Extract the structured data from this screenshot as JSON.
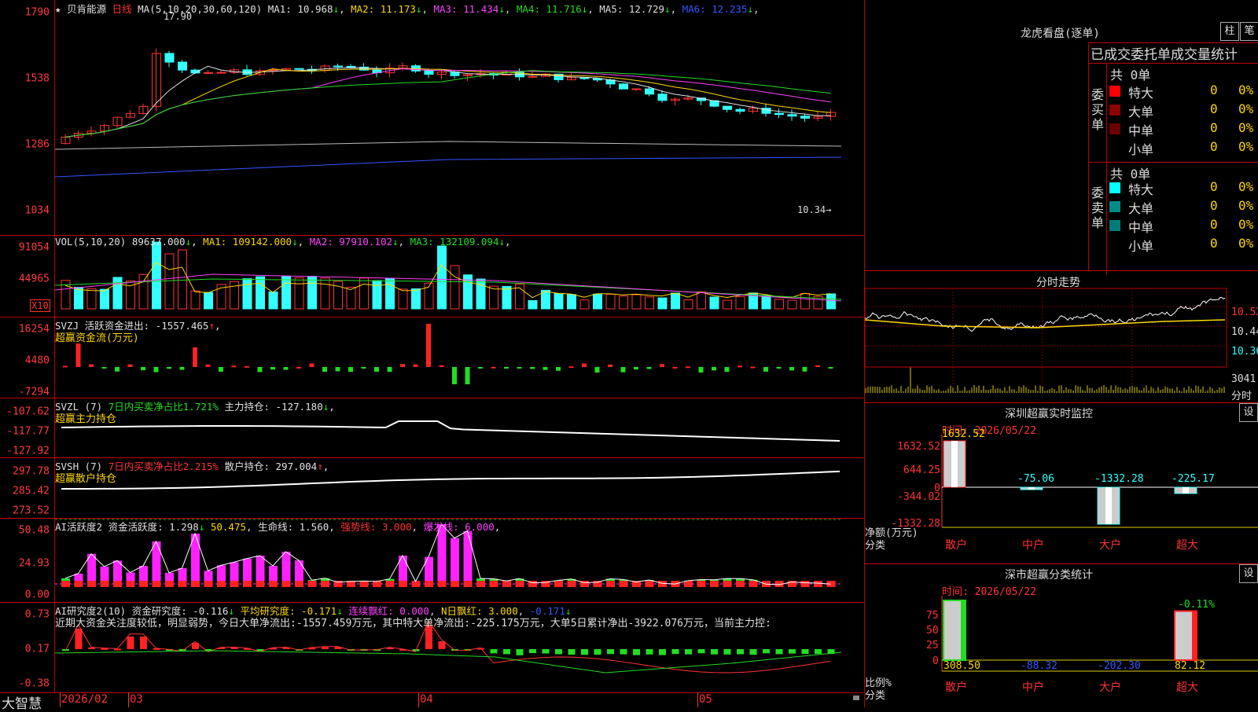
{
  "stock": {
    "name": "贝肯能源",
    "period": "日线",
    "star": "★"
  },
  "price_panel": {
    "ma_label": "MA(5,10,20,30,60,120)",
    "ma": [
      {
        "label": "MA1:",
        "value": "10.968",
        "arrow": "↓",
        "color": "#e0e0e0"
      },
      {
        "label": "MA2:",
        "value": "11.173",
        "arrow": "↓",
        "color": "#ffd700"
      },
      {
        "label": "MA3:",
        "value": "11.434",
        "arrow": "↓",
        "color": "#ff40ff"
      },
      {
        "label": "MA4:",
        "value": "11.716",
        "arrow": "↓",
        "color": "#22dd22"
      },
      {
        "label": "MA5:",
        "value": "12.729",
        "arrow": "↓",
        "color": "#dddddd"
      },
      {
        "label": "MA6:",
        "value": "12.235",
        "arrow": "↓",
        "color": "#3355ff"
      }
    ],
    "y_labels": [
      "1790",
      "1538",
      "1286",
      "1034"
    ],
    "high_label": "17.90",
    "last_label": "10.34",
    "last_arrow": "→"
  },
  "vol_panel": {
    "label": "VOL(5,10,20)",
    "value": "89637.000",
    "value_arrow": "↓",
    "ma": [
      {
        "label": "MA1:",
        "value": "109142.000",
        "arrow": "↓",
        "color": "#ffd700"
      },
      {
        "label": "MA2:",
        "value": "97910.102",
        "arrow": "↓",
        "color": "#ff40ff"
      },
      {
        "label": "MA3:",
        "value": "132109.094",
        "arrow": "↓",
        "color": "#22dd22"
      }
    ],
    "y_labels": [
      "91054",
      "44965"
    ],
    "unit_box": "X10"
  },
  "svzj_panel": {
    "label": "SVZJ",
    "metric_label": "活跃资金进出:",
    "metric_value": "-1557.465",
    "metric_arrow": "↑",
    "subtitle": "超赢资金流(万元)",
    "y_labels": [
      "16254",
      "4480",
      "-7294"
    ]
  },
  "svzl_panel": {
    "label": "SVZL (7)",
    "ratio_text": "7日内买卖净占比1.721%",
    "metric_label": "主力持仓:",
    "metric_value": "-127.180",
    "metric_arrow": "↓",
    "subtitle": "超赢主力持仓",
    "y_labels": [
      "-107.62",
      "-117.77",
      "-127.92"
    ]
  },
  "svsh_panel": {
    "label": "SVSH (7)",
    "ratio_text": "7日内买卖净占比2.215%",
    "metric_label": "散户持仓:",
    "metric_value": "297.004",
    "metric_arrow": "↑",
    "subtitle": "超赢散户持仓",
    "y_labels": [
      "297.78",
      "285.42",
      "273.52"
    ]
  },
  "ai_active_panel": {
    "label": "AI活跃度2",
    "items": [
      {
        "text": "资金活跃度:",
        "value": "1.298",
        "arrow": "↓",
        "color": "#e0e0e0"
      },
      {
        "text": "",
        "value": "50.475",
        "arrow": ",",
        "color": "#ffd700"
      },
      {
        "text": "生命线:",
        "value": "1.560",
        "arrow": ",",
        "color": "#e0e0e0"
      },
      {
        "text": "强势线:",
        "value": "3.000",
        "arrow": ",",
        "color": "#ff3333"
      },
      {
        "text": "爆发线:",
        "value": "6.000",
        "arrow": ",",
        "color": "#ff40ff"
      }
    ],
    "y_labels": [
      "50.48",
      "24.93",
      "0.00"
    ]
  },
  "ai_research_panel": {
    "label": "AI研究度2(10)",
    "items": [
      {
        "text": "资金研究度:",
        "value": "-0.116",
        "arrow": "↓",
        "color": "#e0e0e0"
      },
      {
        "text": "平均研究度:",
        "value": "-0.171",
        "arrow": "↓",
        "color": "#ffd700"
      },
      {
        "text": "连续飘红:",
        "value": "0.000",
        "arrow": ",",
        "color": "#ff40ff"
      },
      {
        "text": "N日飘红:",
        "value": "3.000",
        "arrow": ",",
        "color": "#ffd700"
      },
      {
        "text": "",
        "value": "-0.171",
        "arrow": "↓",
        "color": "#3355ff"
      }
    ],
    "comment": "近期大资金关注度较低，明显弱势，今日大单净流出:-1557.459万元，其中特大单净流出:-225.175万元，大单5日累计净出-3922.076万元，当前主力控:",
    "y_labels": [
      "0.73",
      "0.17",
      "-0.38"
    ]
  },
  "bottom_bar": {
    "logo": "大智慧",
    "dates": [
      "2026/02",
      "03",
      "04",
      "05"
    ]
  },
  "dragon_tiger": {
    "title": "龙虎看盘(逐单)",
    "btn_bar": "柱",
    "btn_pen": "笔",
    "header": "已成交委托单成交量统计",
    "buy": {
      "side": "委买单",
      "total": "共 0单",
      "rows": [
        {
          "label": "特大",
          "count": "0",
          "pct": "0%",
          "color": "#ff0000"
        },
        {
          "label": "大单",
          "count": "0",
          "pct": "0%",
          "color": "#8b0000"
        },
        {
          "label": "中单",
          "count": "0",
          "pct": "0%",
          "color": "#6b0000"
        },
        {
          "label": "小单",
          "count": "0",
          "pct": "0%",
          "color": ""
        }
      ]
    },
    "sell": {
      "side": "委卖单",
      "total": "共 0单",
      "rows": [
        {
          "label": "特大",
          "count": "0",
          "pct": "0%",
          "color": "#00ffff"
        },
        {
          "label": "大单",
          "count": "0",
          "pct": "0%",
          "color": "#008b8b"
        },
        {
          "label": "中单",
          "count": "0",
          "pct": "0%",
          "color": "#007b7b"
        },
        {
          "label": "小单",
          "count": "0",
          "pct": "0%",
          "color": ""
        }
      ]
    }
  },
  "intraday": {
    "title": "分时走势",
    "y_labels": [
      "10.52",
      "10.44",
      "10.36"
    ],
    "vol_label": "3041",
    "vol_unit": "分时"
  },
  "realtime_monitor": {
    "title": "深圳超赢实时监控",
    "btn": "设",
    "time_label": "时间: 2026/05/22",
    "y_labels": [
      "1632.52",
      "644.25",
      "0",
      "-344.02",
      "-1332.28"
    ],
    "axis_title": "净额(万元)",
    "category_title": "分类",
    "chart_data": {
      "type": "bar",
      "categories": [
        "散户",
        "中户",
        "大户",
        "超大"
      ],
      "values": [
        1632.52,
        -75.06,
        -1332.28,
        -225.17
      ],
      "value_labels": [
        "1632.52",
        "-75.06",
        "-1332.28",
        "-225.17"
      ],
      "ylim": [
        -1332.28,
        1632.52
      ]
    }
  },
  "category_stats": {
    "title": "深市超赢分类统计",
    "btn": "设",
    "time_label": "时间: 2026/05/22",
    "y_labels": [
      "75",
      "50",
      "25",
      "0"
    ],
    "axis_title": "比例%",
    "category_title": "分类",
    "top_label": "-0.11%",
    "chart_data": {
      "type": "bar",
      "categories": [
        "散户",
        "中户",
        "大户",
        "超大"
      ],
      "values": [
        308.5,
        -88.32,
        -202.3,
        82.12
      ],
      "value_labels": [
        "308.50",
        "-88.32",
        "-202.30",
        "82.12"
      ],
      "ylim": [
        0,
        100
      ]
    }
  }
}
